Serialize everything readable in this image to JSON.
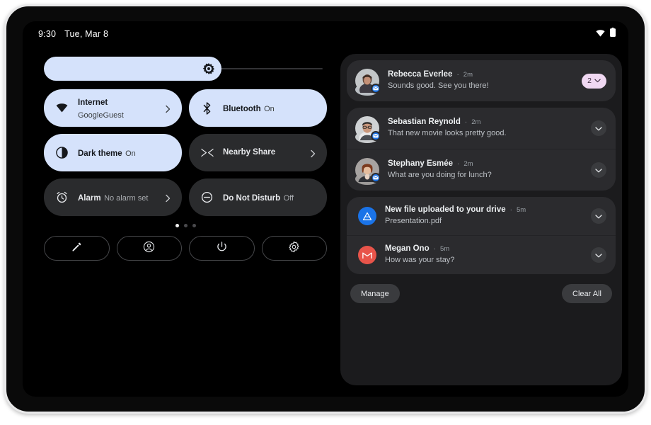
{
  "status_bar": {
    "time": "9:30",
    "date": "Tue, Mar 8",
    "icons": [
      "wifi-icon",
      "battery-icon"
    ]
  },
  "quick_settings": {
    "brightness": {
      "label": "Brightness",
      "icon": "brightness-icon",
      "value_percent": 63
    },
    "tiles": [
      {
        "name": "internet",
        "label": "Internet",
        "sub": "GoogleGuest",
        "state": "active",
        "icon": "wifi-icon",
        "chevron": true
      },
      {
        "name": "bluetooth",
        "label": "Bluetooth",
        "sub": "On",
        "state": "active",
        "icon": "bluetooth-icon",
        "chevron": false
      },
      {
        "name": "dark-theme",
        "label": "Dark theme",
        "sub": "On",
        "state": "active",
        "icon": "dark-theme-icon",
        "chevron": false
      },
      {
        "name": "nearby-share",
        "label": "Nearby Share",
        "sub": "",
        "state": "inactive",
        "icon": "nearby-share-icon",
        "chevron": true
      },
      {
        "name": "alarm",
        "label": "Alarm",
        "sub": "No alarm set",
        "state": "inactive",
        "icon": "alarm-icon",
        "chevron": true
      },
      {
        "name": "do-not-disturb",
        "label": "Do Not Disturb",
        "sub": "Off",
        "state": "inactive",
        "icon": "do-not-disturb-icon",
        "chevron": false
      }
    ],
    "pages": {
      "count": 3,
      "active_index": 0
    },
    "footer_buttons": [
      {
        "name": "edit-tiles",
        "icon": "pencil-icon"
      },
      {
        "name": "user-switch",
        "icon": "account-icon"
      },
      {
        "name": "power",
        "icon": "power-icon"
      },
      {
        "name": "settings",
        "icon": "gear-icon"
      }
    ]
  },
  "notifications": {
    "groups": [
      {
        "items": [
          {
            "name": "rebecca-everlee",
            "title": "Rebecca Everlee",
            "separator": "·",
            "time": "2m",
            "text": "Sounds good. See you there!",
            "avatar": "photo-avatar-female-1",
            "avatar_color": "#b9bec3",
            "app_badge": "messages-icon",
            "app_badge_color": "#1a73e8",
            "action": "count-badge",
            "count": "2"
          }
        ]
      },
      {
        "items": [
          {
            "name": "sebastian-reynold",
            "title": "Sebastian Reynold",
            "separator": "·",
            "time": "2m",
            "text": "That new movie looks pretty good.",
            "avatar": "photo-avatar-male-1",
            "avatar_color": "#c9ccce",
            "app_badge": "messages-icon",
            "app_badge_color": "#1a73e8",
            "action": "expand"
          },
          {
            "name": "stephany-esmee",
            "title": "Stephany Esmée",
            "separator": "·",
            "time": "2m",
            "text": "What are you doing for lunch?",
            "avatar": "photo-avatar-female-2",
            "avatar_color": "#9e9b9a",
            "app_badge": "messages-icon",
            "app_badge_color": "#1a73e8",
            "action": "expand"
          }
        ]
      },
      {
        "items": [
          {
            "name": "drive-upload",
            "title": "New file uploaded to your drive",
            "separator": "·",
            "time": "5m",
            "text": "Presentation.pdf",
            "avatar": "drive-icon",
            "avatar_color": "#1a73e8",
            "action": "expand"
          },
          {
            "name": "megan-ono",
            "title": "Megan Ono",
            "separator": "·",
            "time": "5m",
            "text": "How was your stay?",
            "avatar": "gmail-icon",
            "avatar_color": "#ea4335",
            "action": "expand"
          }
        ]
      }
    ],
    "footer": {
      "manage_label": "Manage",
      "clear_all_label": "Clear All"
    }
  },
  "theme": {
    "accent_active_tile": "#d5e2fb",
    "inactive_tile": "#2a2b2d",
    "panel_bg": "#1b1b1d",
    "card_bg": "#2b2b2e",
    "badge_pink": "#f0d8f2",
    "screen_bg": "#000000"
  }
}
